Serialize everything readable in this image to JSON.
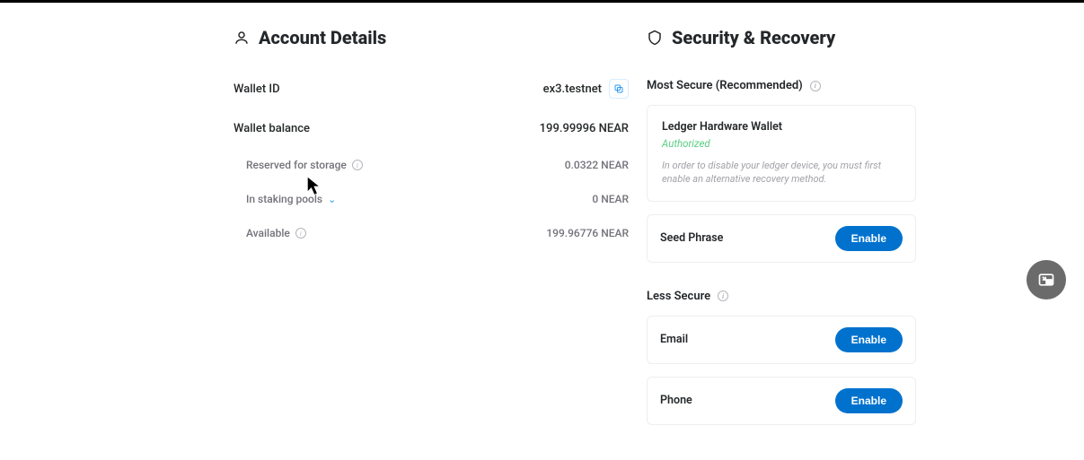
{
  "account": {
    "title": "Account Details",
    "wallet_id_label": "Wallet ID",
    "wallet_id_value": "ex3.testnet",
    "wallet_balance_label": "Wallet balance",
    "wallet_balance_value": "199.99996 NEAR",
    "reserved_label": "Reserved for storage",
    "reserved_value": "0.0322 NEAR",
    "staking_label": "In staking pools",
    "staking_value": "0 NEAR",
    "available_label": "Available",
    "available_value": "199.96776 NEAR"
  },
  "security": {
    "title": "Security & Recovery",
    "most_secure_label": "Most Secure (Recommended)",
    "ledger": {
      "title": "Ledger Hardware Wallet",
      "status": "Authorized",
      "desc": "In order to disable your ledger device, you must first enable an alternative recovery method."
    },
    "seed_phrase_label": "Seed Phrase",
    "less_secure_label": "Less Secure",
    "email_label": "Email",
    "phone_label": "Phone",
    "enable_label": "Enable"
  }
}
